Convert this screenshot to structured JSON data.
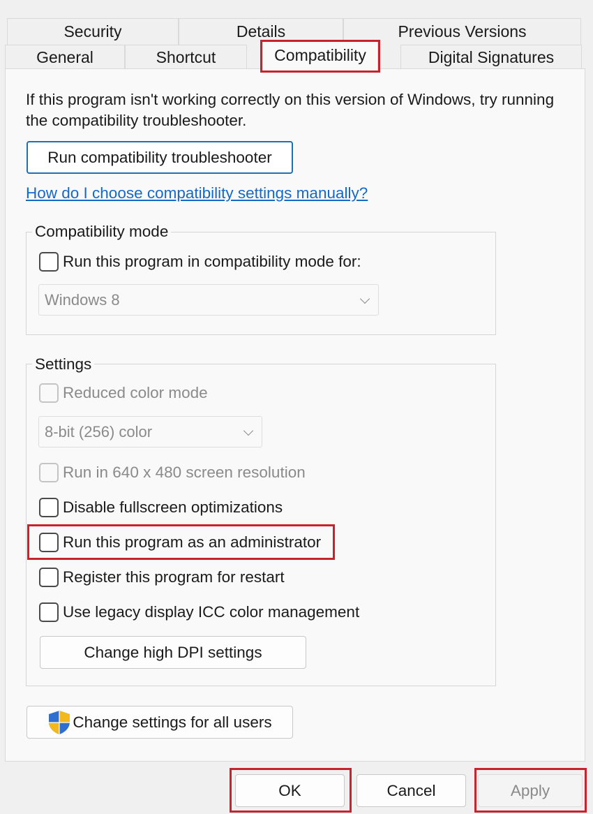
{
  "tabs": {
    "row1": [
      "Security",
      "Details",
      "Previous Versions"
    ],
    "row2": [
      "General",
      "Shortcut",
      "Compatibility",
      "Digital Signatures"
    ]
  },
  "intro_text": "If this program isn't working correctly on this version of Windows, try running the compatibility troubleshooter.",
  "troubleshooter_button": "Run compatibility troubleshooter",
  "help_link": "How do I choose compatibility settings manually?",
  "compat_mode": {
    "title": "Compatibility mode",
    "checkbox_label": "Run this program in compatibility mode for:",
    "checked": false,
    "select_value": "Windows 8"
  },
  "settings": {
    "title": "Settings",
    "reduced_color": {
      "label": "Reduced color mode",
      "checked": false,
      "enabled": false
    },
    "color_select_value": "8-bit (256) color",
    "res_640": {
      "label": "Run in 640 x 480 screen resolution",
      "checked": false,
      "enabled": false
    },
    "disable_fullscreen": {
      "label": "Disable fullscreen optimizations",
      "checked": false
    },
    "run_as_admin": {
      "label": "Run this program as an administrator",
      "checked": false
    },
    "register_restart": {
      "label": "Register this program for restart",
      "checked": false
    },
    "legacy_icc": {
      "label": "Use legacy display ICC color management",
      "checked": false
    },
    "dpi_button": "Change high DPI settings"
  },
  "all_users_button": "Change settings for all users",
  "dialog_buttons": {
    "ok": "OK",
    "cancel": "Cancel",
    "apply": "Apply"
  },
  "colors": {
    "highlight": "#c8232c",
    "link": "#1569c7",
    "accent_border": "#1f6fb2"
  }
}
